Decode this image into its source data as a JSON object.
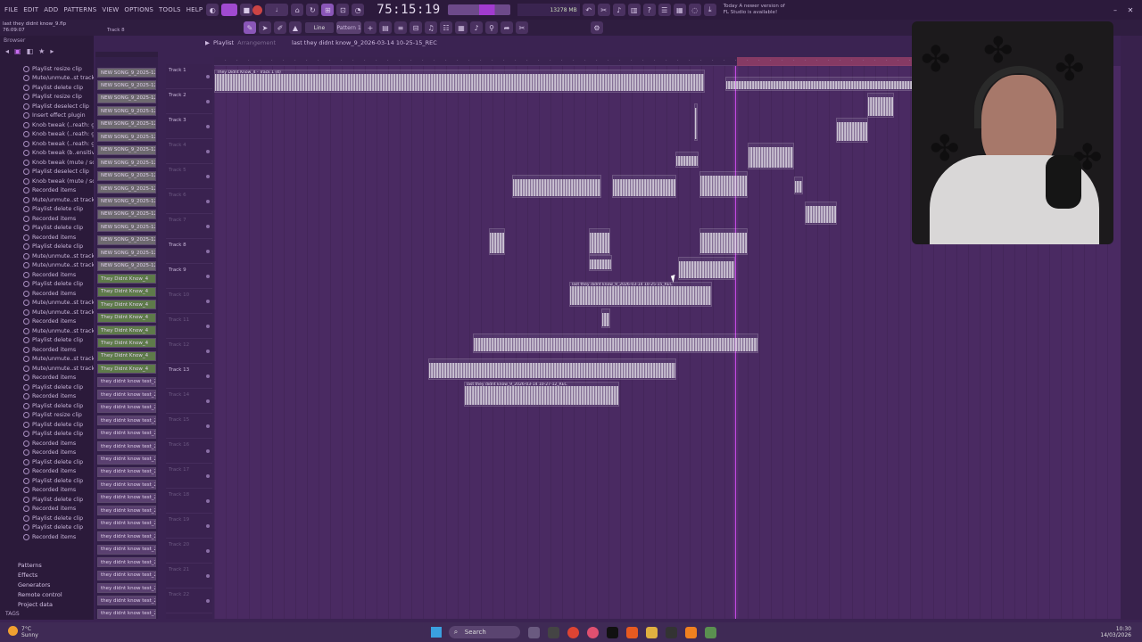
{
  "menu": [
    "FILE",
    "EDIT",
    "ADD",
    "PATTERNS",
    "VIEW",
    "OPTIONS",
    "TOOLS",
    "HELP"
  ],
  "transport": {
    "time": "75:15:19",
    "pattern_label": "Pattern 1"
  },
  "news_text": "Today  A newer version of FL Studio is available!",
  "cpu_text": "13278 MB",
  "project": {
    "file": "last they didnt know_9.flp",
    "elapsed": "76:09:07",
    "track_hint": "Track 8"
  },
  "toolbar2": {
    "snap": "Line"
  },
  "playlist": {
    "title": "Playlist",
    "section": "Arrangement",
    "name": "last they didnt know_9_2026-03-14 10-25-15_REC"
  },
  "browser": {
    "header": "Browser",
    "history": [
      "Playlist resize clip",
      "Mute/unmute..st track(s)",
      "Playlist delete clip",
      "Playlist resize clip",
      "Playlist deselect clip",
      "Insert effect plugin",
      "Knob tweak (..reath: gain)",
      "Knob tweak (..reath: gain)",
      "Knob tweak (..reath: gain)",
      "Knob tweak (b..ensitivity)",
      "Knob tweak (mute / solo)",
      "Playlist deselect clip",
      "Knob tweak (mute / solo)",
      "Recorded items",
      "Mute/unmute..st track(s)",
      "Playlist delete clip",
      "Recorded items",
      "Playlist delete clip",
      "Recorded items",
      "Playlist delete clip",
      "Mute/unmute..st track(s)",
      "Mute/unmute..st track(s)",
      "Recorded items",
      "Playlist delete clip",
      "Recorded items",
      "Mute/unmute..st track(s)",
      "Mute/unmute..st track(s)",
      "Recorded items",
      "Mute/unmute..st track(s)",
      "Playlist delete clip",
      "Recorded items",
      "Mute/unmute..st track(s)",
      "Mute/unmute..st track(s)",
      "Recorded items",
      "Playlist delete clip",
      "Recorded items",
      "Playlist delete clip",
      "Playlist resize clip",
      "Playlist delete clip",
      "Playlist delete clip",
      "Recorded items",
      "Recorded items",
      "Playlist delete clip",
      "Recorded items",
      "Playlist delete clip",
      "Recorded items",
      "Playlist delete clip",
      "Recorded items",
      "Playlist delete clip",
      "Playlist delete clip",
      "Recorded items"
    ],
    "tree": [
      "Patterns",
      "Effects",
      "Generators",
      "Remote control",
      "Project data"
    ],
    "tags_label": "TAGS"
  },
  "channels": [
    {
      "label": "NEW SONG_9_2025-12-2",
      "kind": "grey"
    },
    {
      "label": "NEW SONG_9_2025-12-2",
      "kind": "grey"
    },
    {
      "label": "NEW SONG_9_2025-12-2",
      "kind": "grey"
    },
    {
      "label": "NEW SONG_9_2025-12-2",
      "kind": "grey"
    },
    {
      "label": "NEW SONG_9_2025-12-2",
      "kind": "grey"
    },
    {
      "label": "NEW SONG_9_2025-12-2",
      "kind": "grey"
    },
    {
      "label": "NEW SONG_9_2025-12-2",
      "kind": "grey"
    },
    {
      "label": "NEW SONG_9_2025-12-2",
      "kind": "grey"
    },
    {
      "label": "NEW SONG_9_2025-12-2",
      "kind": "grey"
    },
    {
      "label": "NEW SONG_9_2025-12-2",
      "kind": "grey"
    },
    {
      "label": "NEW SONG_9_2025-12-2",
      "kind": "grey"
    },
    {
      "label": "NEW SONG_9_2025-12-2",
      "kind": "grey"
    },
    {
      "label": "NEW SONG_9_2025-12-2",
      "kind": "grey"
    },
    {
      "label": "NEW SONG_9_2025-12-2",
      "kind": "grey"
    },
    {
      "label": "NEW SONG_9_2025-12-2",
      "kind": "grey"
    },
    {
      "label": "NEW SONG_9_2025-12-2",
      "kind": "grey"
    },
    {
      "label": "They Didnt Know_4",
      "kind": "green"
    },
    {
      "label": "They Didnt Know_4",
      "kind": "green"
    },
    {
      "label": "They Didnt Know_4",
      "kind": "green"
    },
    {
      "label": "They Didnt Know_4",
      "kind": "green"
    },
    {
      "label": "They Didnt Know_4",
      "kind": "green"
    },
    {
      "label": "They Didnt Know_4",
      "kind": "green"
    },
    {
      "label": "They Didnt Know_4",
      "kind": "green"
    },
    {
      "label": "They Didnt Know_4",
      "kind": "green"
    },
    {
      "label": "they didnt know test_20",
      "kind": "purple"
    },
    {
      "label": "they didnt know test_20",
      "kind": "purple"
    },
    {
      "label": "they didnt know test_20",
      "kind": "purple"
    },
    {
      "label": "they didnt know test_20",
      "kind": "purple"
    },
    {
      "label": "they didnt know test_20",
      "kind": "purple"
    },
    {
      "label": "they didnt know test_20",
      "kind": "purple"
    },
    {
      "label": "they didnt know test_20",
      "kind": "purple"
    },
    {
      "label": "they didnt know test_20",
      "kind": "purple"
    },
    {
      "label": "they didnt know test_20",
      "kind": "purple"
    },
    {
      "label": "they didnt know test_20",
      "kind": "purple"
    },
    {
      "label": "they didnt know test_20",
      "kind": "purple"
    },
    {
      "label": "they didnt know test_20",
      "kind": "purple"
    },
    {
      "label": "they didnt know test_20",
      "kind": "purple"
    },
    {
      "label": "they didnt know test_20",
      "kind": "purple"
    },
    {
      "label": "they didnt know test_20",
      "kind": "purple"
    },
    {
      "label": "they didnt know test_20",
      "kind": "purple"
    },
    {
      "label": "they didnt know test_20",
      "kind": "purple"
    },
    {
      "label": "they didnt know test_20",
      "kind": "purple"
    },
    {
      "label": "they didnt know test_20",
      "kind": "purple"
    }
  ],
  "tracks": [
    {
      "label": "Track 1",
      "dim": false
    },
    {
      "label": "Track 2",
      "dim": false
    },
    {
      "label": "Track 3",
      "dim": false
    },
    {
      "label": "Track 4",
      "dim": true
    },
    {
      "label": "Track 5",
      "dim": true
    },
    {
      "label": "Track 6",
      "dim": true
    },
    {
      "label": "Track 7",
      "dim": true
    },
    {
      "label": "Track 8",
      "dim": false
    },
    {
      "label": "Track 9",
      "dim": false
    },
    {
      "label": "Track 10",
      "dim": true
    },
    {
      "label": "Track 11",
      "dim": true
    },
    {
      "label": "Track 12",
      "dim": true
    },
    {
      "label": "Track 13",
      "dim": false
    },
    {
      "label": "Track 14",
      "dim": true
    },
    {
      "label": "Track 15",
      "dim": true
    },
    {
      "label": "Track 16",
      "dim": true
    },
    {
      "label": "Track 17",
      "dim": true
    },
    {
      "label": "Track 18",
      "dim": true
    },
    {
      "label": "Track 19",
      "dim": true
    },
    {
      "label": "Track 20",
      "dim": true
    },
    {
      "label": "Track 21",
      "dim": true
    },
    {
      "label": "Track 22",
      "dim": true
    }
  ],
  "clips": [
    {
      "label": "They Didnt Know_4 - Track 1 (4)",
      "wide": true
    },
    {
      "label": "last they didnt know_9_2026-03-14 10-25-15_REC",
      "wide": true
    },
    {
      "label": "last they didnt know_9_2026-03-14 10-27-12_REC",
      "wide": true
    }
  ],
  "taskbar": {
    "weather_temp": "7°C",
    "weather_desc": "Sunny",
    "search": "Search",
    "time": "10:30",
    "date": "14/03/2026"
  },
  "colors": {
    "accent": "#c04ae0",
    "bg": "#4a2a62",
    "loop": "#a0436b"
  }
}
